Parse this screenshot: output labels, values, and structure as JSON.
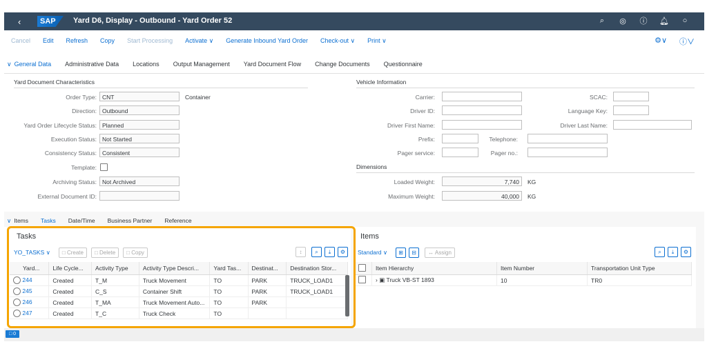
{
  "shell": {
    "title": "Yard D6, Display - Outbound - Yard Order 52",
    "logo": "SAP",
    "icons": [
      "search-icon",
      "binoculars-icon",
      "help-icon",
      "bell-icon",
      "user-icon"
    ]
  },
  "toolbar": {
    "cancel": "Cancel",
    "edit": "Edit",
    "refresh": "Refresh",
    "copy": "Copy",
    "start_processing": "Start Processing",
    "activate": "Activate",
    "generate_inbound": "Generate Inbound Yard Order",
    "check_out": "Check-out",
    "print": "Print"
  },
  "tabs": [
    "General Data",
    "Administrative Data",
    "Locations",
    "Output Management",
    "Yard Document Flow",
    "Change Documents",
    "Questionnaire"
  ],
  "yard_doc": {
    "section": "Yard Document Characteristics",
    "order_type_label": "Order Type:",
    "order_type": "CNT",
    "order_type_desc": "Container",
    "direction_label": "Direction:",
    "direction": "Outbound",
    "lifecycle_label": "Yard Order Lifecycle Status:",
    "lifecycle": "Planned",
    "execution_label": "Execution Status:",
    "execution": "Not Started",
    "consistency_label": "Consistency Status:",
    "consistency": "Consistent",
    "template_label": "Template:",
    "archiving_label": "Archiving Status:",
    "archiving": "Not Archived",
    "external_label": "External Document ID:",
    "external": ""
  },
  "vehicle": {
    "section": "Vehicle Information",
    "carrier_label": "Carrier:",
    "scac_label": "SCAC:",
    "driver_id_label": "Driver ID:",
    "language_label": "Language Key:",
    "driver_first_label": "Driver First Name:",
    "driver_last_label": "Driver Last Name:",
    "prefix_label": "Prefix:",
    "telephone_label": "Telephone:",
    "pager_service_label": "Pager service:",
    "pager_no_label": "Pager no.:"
  },
  "dimensions": {
    "section": "Dimensions",
    "loaded_label": "Loaded Weight:",
    "loaded": "7,740",
    "max_label": "Maximum Weight:",
    "max": "40,000",
    "unit": "KG"
  },
  "subtabs": [
    "Items",
    "Tasks",
    "Date/Time",
    "Business Partner",
    "Reference"
  ],
  "tasks": {
    "title": "Tasks",
    "variant": "YO_TASKS",
    "create": "Create",
    "delete": "Delete",
    "copy": "Copy",
    "columns": [
      "Yard...",
      "Life Cycle...",
      "Activity Type",
      "Activity Type Descri...",
      "Yard Tas...",
      "Destinat...",
      "Destination Stor..."
    ],
    "rows": [
      [
        "244",
        "Created",
        "T_M",
        "Truck Movement",
        "TO",
        "PARK",
        "TRUCK_LOAD1"
      ],
      [
        "245",
        "Created",
        "C_S",
        "Container Shift",
        "TO",
        "PARK",
        "TRUCK_LOAD1"
      ],
      [
        "246",
        "Created",
        "T_MA",
        "Truck Movement Auto...",
        "TO",
        "PARK",
        ""
      ],
      [
        "247",
        "Created",
        "T_C",
        "Truck Check",
        "TO",
        "",
        ""
      ]
    ]
  },
  "items": {
    "title": "Items",
    "variant": "Standard",
    "assign": "Assign",
    "columns": [
      "Item Hierarchy",
      "Item Number",
      "Transportation Unit Type"
    ],
    "rows": [
      [
        "Truck VB-ST 1893",
        "10",
        "TR0"
      ]
    ]
  },
  "colors": {
    "shell": "#354a5f",
    "link": "#0a6ed1",
    "highlight": "#f5a500"
  }
}
